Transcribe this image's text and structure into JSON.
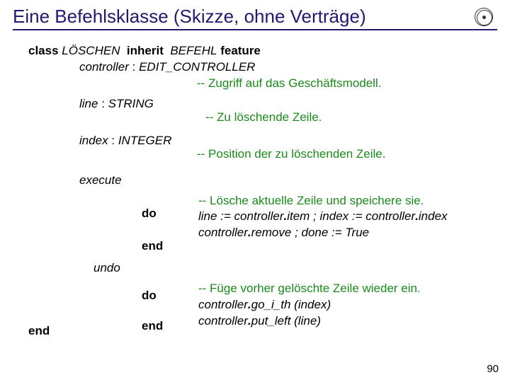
{
  "title": "Eine Befehlsklasse (Skizze, ohne Verträge)",
  "page_number": "90",
  "kw": {
    "class": "class",
    "inherit": "inherit",
    "feature": "feature",
    "do": "do",
    "end": "end"
  },
  "decl": {
    "class_name": "LÖSCHEN",
    "parent": "BEFEHL",
    "controller": "controller",
    "controller_type": "EDIT_CONTROLLER",
    "controller_comment": "-- Zugriff auf das Geschäftsmodell.",
    "line": "line",
    "line_type": "STRING",
    "line_comment": "-- Zu löschende Zeile.",
    "index": "index",
    "index_type": "INTEGER",
    "index_comment": "-- Position der zu löschenden Zeile.",
    "execute": "execute",
    "undo": "undo"
  },
  "exec": {
    "comment": "-- Lösche aktuelle Zeile und speichere sie.",
    "l1a": "line := controller",
    "l1b": "item ; index := controller",
    "l1c": "index",
    "l2a": "controller",
    "l2b": "remove ; done := True"
  },
  "undo_body": {
    "comment": "-- Füge vorher gelöschte Zeile wieder ein.",
    "l1a": "controller",
    "l1b": "go_i_th (index)",
    "l2a": "controller",
    "l2b": "put_left (line)"
  },
  "punct": {
    "colon": " : ",
    "dot": "."
  }
}
